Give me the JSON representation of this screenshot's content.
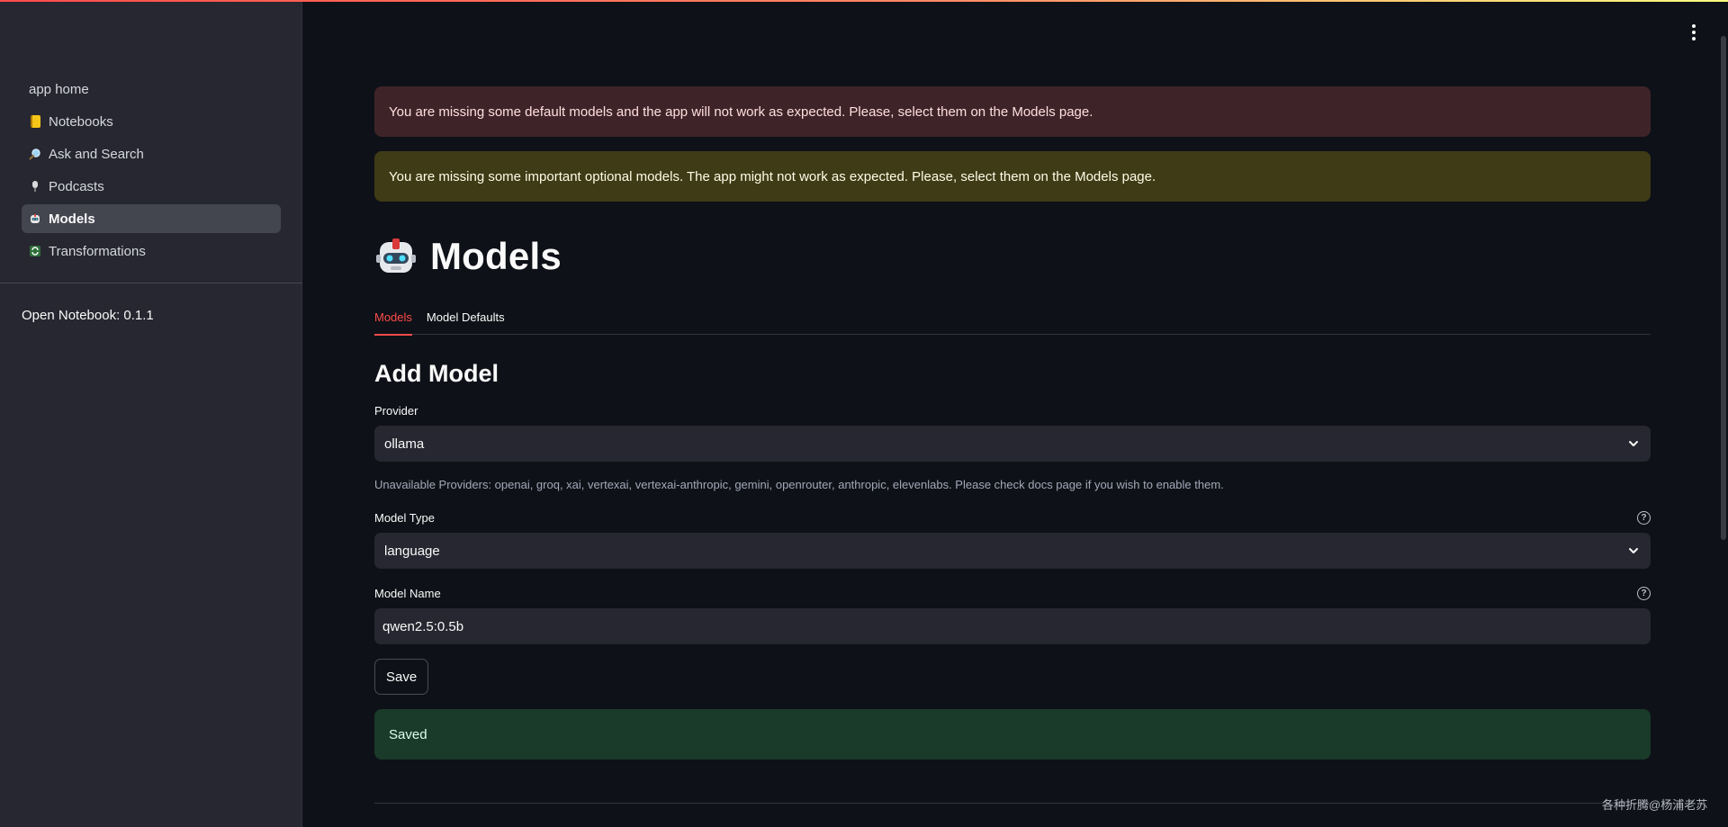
{
  "sidebar": {
    "items": [
      {
        "label": "app home",
        "icon": "none"
      },
      {
        "label": "Notebooks",
        "icon": "notebook-icon"
      },
      {
        "label": "Ask and Search",
        "icon": "magnifier-icon"
      },
      {
        "label": "Podcasts",
        "icon": "microphone-icon"
      },
      {
        "label": "Models",
        "icon": "robot-icon"
      },
      {
        "label": "Transformations",
        "icon": "cycle-arrows-icon"
      }
    ],
    "active_item": "Models",
    "version": "Open Notebook: 0.1.1"
  },
  "alerts": {
    "error": "You are missing some default models and the app will not work as expected. Please, select them on the Models page.",
    "warning": "You are missing some important optional models. The app might not work as expected. Please, select them on the Models page.",
    "success": "Saved"
  },
  "page": {
    "title": "Models",
    "tabs": [
      {
        "label": "Models",
        "active": true
      },
      {
        "label": "Model Defaults",
        "active": false
      }
    ]
  },
  "form": {
    "section_title": "Add Model",
    "provider": {
      "label": "Provider",
      "value": "ollama"
    },
    "unavailable_caption": "Unavailable Providers: openai, groq, xai, vertexai, vertexai-anthropic, gemini, openrouter, anthropic, elevenlabs. Please check docs page if you wish to enable them.",
    "model_type": {
      "label": "Model Type",
      "value": "language"
    },
    "model_name": {
      "label": "Model Name",
      "value": "qwen2.5:0.5b"
    },
    "save_label": "Save"
  },
  "watermark": "各种折腾@杨浦老苏",
  "colors": {
    "accent": "#ff4b4b",
    "background": "#0e1117",
    "sidebar": "#262730",
    "error_bg": "#3e2428",
    "warning_bg": "#3e3b16",
    "success_bg": "#1a3a2a"
  }
}
